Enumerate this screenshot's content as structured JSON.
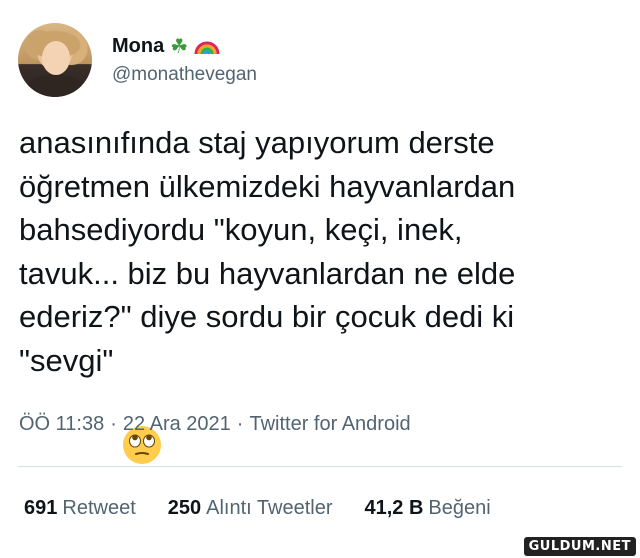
{
  "author": {
    "display_name": "Mona",
    "handle": "@monathevegan",
    "badges": [
      "shamrock-emoji",
      "rainbow-emoji"
    ]
  },
  "tweet": {
    "text": "anasınıfında staj yapıyorum derste\nöğretmen ülkemizdeki hayvanlardan\nbahsediyordu \"koyun, keçi, inek,\ntavuk... biz bu hayvanlardan ne elde\nederiz?\" diye sordu bir çocuk dedi ki\n\"sevgi\"",
    "emoji": "face-with-rolling-eyes-emoji"
  },
  "meta": {
    "time": "ÖÖ 11:38",
    "separator1": "·",
    "date": "22 Ara 2021",
    "separator2": "·",
    "source": "Twitter for Android"
  },
  "stats": {
    "retweets_count": "691",
    "retweets_label": "Retweet",
    "quotes_count": "250",
    "quotes_label": "Alıntı Tweetler",
    "likes_count": "41,2 B",
    "likes_label": "Beğeni"
  },
  "watermark": "GULDUM.NET",
  "colors": {
    "text": "#0f1419",
    "secondary": "#536471",
    "divider": "#d9e0e4",
    "background": "#ffffff"
  }
}
